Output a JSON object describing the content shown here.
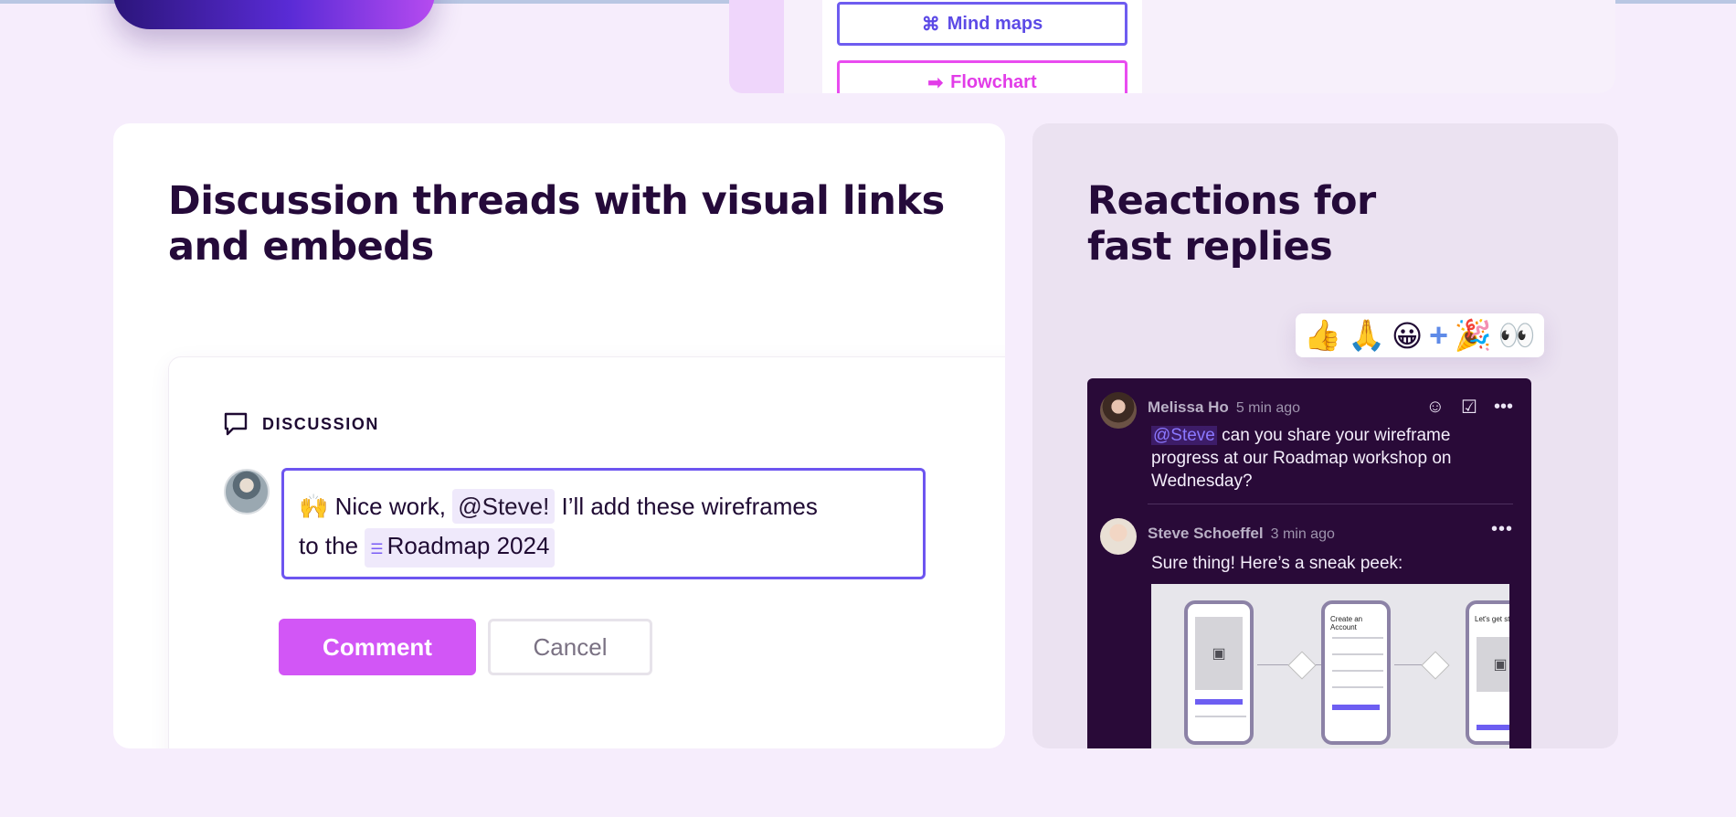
{
  "top_section": {
    "mind_maps_label": "Mind maps",
    "flowchart_label": "Flowchart"
  },
  "left_card": {
    "title": "Discussion threads with visual links and embeds",
    "discussion": {
      "header": "DISCUSSION",
      "comment": {
        "emoji": "🙌",
        "text_before": "Nice work,",
        "mention": "@Steve!",
        "text_middle": "I’ll add these wireframes",
        "text_line2": "to the",
        "link_chip": "Roadmap 2024"
      },
      "comment_button": "Comment",
      "cancel_button": "Cancel"
    }
  },
  "right_card": {
    "title": "Reactions for fast replies",
    "reactions": [
      "👍",
      "🙏",
      "😀",
      "+",
      "🎉",
      "👀"
    ],
    "messages": [
      {
        "author": "Melissa Ho",
        "time": "5 min ago",
        "mention": "@Steve",
        "text": "can you share your wireframe progress at our Roadmap workshop on Wednesday?"
      },
      {
        "author": "Steve Schoeffel",
        "time": "3 min ago",
        "text": "Sure thing! Here’s a sneak peek:"
      }
    ],
    "preview": {
      "create_account_title": "Create an Account",
      "lets_get_title": "Let's get st"
    }
  },
  "colors": {
    "page_bg": "#f6edfc",
    "accent_purple": "#6d55f0",
    "accent_magenta": "#d256f6",
    "dark_panel": "#290a38"
  }
}
